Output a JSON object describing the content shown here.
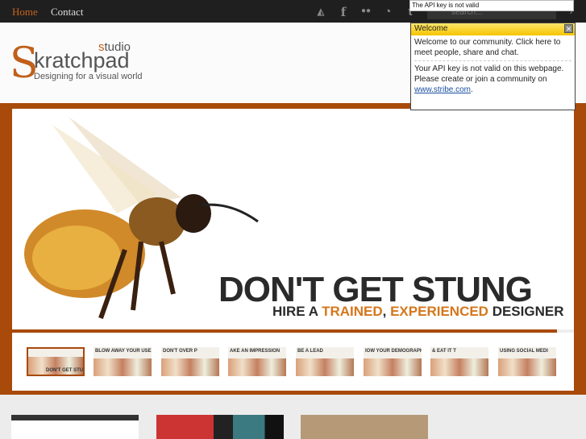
{
  "nav": {
    "home": "Home",
    "contact": "Contact"
  },
  "social_icons": [
    "delicious-icon",
    "facebook-icon",
    "flickr-icon",
    "rss-icon",
    "tumblr-icon"
  ],
  "search": {
    "placeholder": "search...",
    "button": "›"
  },
  "api_tooltip": "The API key is not valid",
  "logo": {
    "text": "Skratchpad",
    "studio": "studio",
    "tagline": "Designing for a visual world"
  },
  "popup": {
    "title": "Welcome",
    "intro": "Welcome to our community. Click here to meet people, share and chat.",
    "warning": "Your API key is not valid on this webpage.",
    "join": "Please create or join a community on",
    "link": "www.stribe.com",
    "close": "✕"
  },
  "slide": {
    "headline": "DON'T GET STUNG",
    "sub_pre": "HIRE A ",
    "sub_o1": "TRAINED",
    "sub_mid": ", ",
    "sub_o2": "EXPERIENCED",
    "sub_post": " DESIGNER",
    "progress": 0.97
  },
  "thumbs": [
    "DON'T GET STU",
    "BLOW AWAY YOUR USE",
    "DON'T OVER P",
    "AKE AN IMPRESSION",
    "BE A LEAD",
    "IOW YOUR DEMOGRAPHI",
    "& EAT IT T",
    "USING SOCIAL MEDI"
  ],
  "colors": {
    "accent": "#a84a0a",
    "nav_active": "#c8641a",
    "popup_header": "#f5c400"
  }
}
